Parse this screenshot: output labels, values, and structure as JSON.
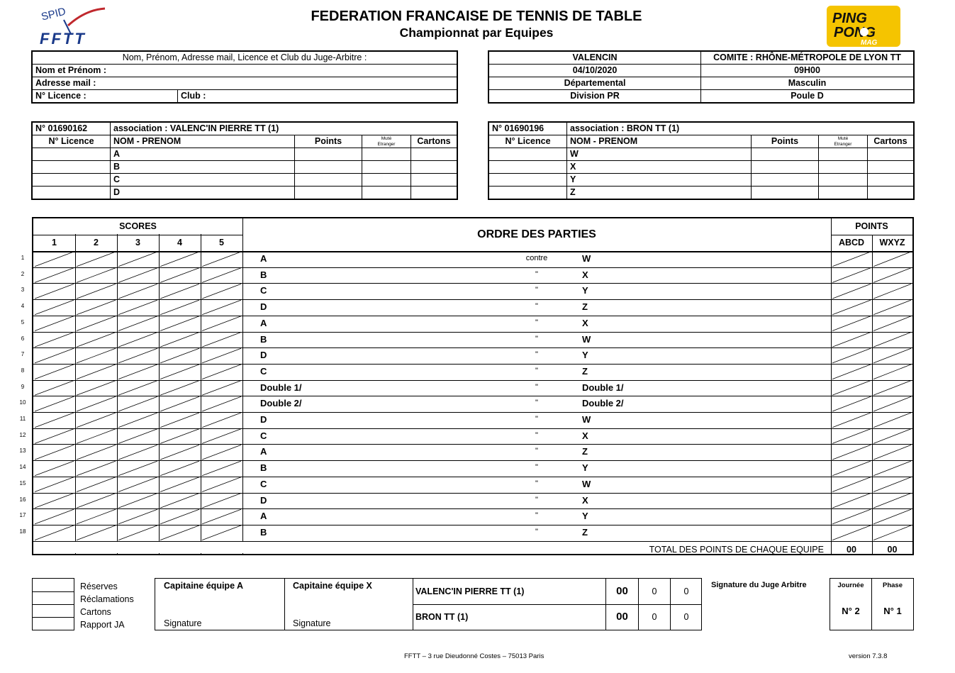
{
  "header": {
    "title": "FEDERATION FRANCAISE DE TENNIS DE TABLE",
    "subtitle": "Championnat par Equipes",
    "logo_left": "SPID FFTT",
    "logo_right": "PING PONG MAG"
  },
  "referee": {
    "heading": "Nom, Prénom, Adresse mail, Licence et Club du Juge-Arbitre :",
    "name_label": "Nom et Prénom :",
    "email_label": "Adresse mail  :",
    "licence_label": "N° Licence     :",
    "club_label": "Club :"
  },
  "match_info": {
    "location": "VALENCIN",
    "committee": "COMITE : RHÔNE-MÉTROPOLE DE LYON TT",
    "date": "04/10/2020",
    "time": "09H00",
    "level": "Départemental",
    "gender": "Masculin",
    "division": "Division  PR",
    "pool": "Poule D"
  },
  "team_a": {
    "number": "N° 01690162",
    "association": "association : VALENC'IN PIERRE TT  (1)",
    "col_licence": "N° Licence",
    "col_name": "NOM - PRENOM",
    "col_points": "Points",
    "col_mute": "Muté",
    "col_etranger": "Etranger",
    "col_cards": "Cartons",
    "players": [
      "A",
      "B",
      "C",
      "D"
    ]
  },
  "team_x": {
    "number": "N° 01690196",
    "association": "association : BRON TT  (1)",
    "col_licence": "N° Licence",
    "col_name": "NOM - PRENOM",
    "col_points": "Points",
    "col_mute": "Muté",
    "col_etranger": "Etranger",
    "col_cards": "Cartons",
    "players": [
      "W",
      "X",
      "Y",
      "Z"
    ]
  },
  "scores": {
    "heading": "SCORES",
    "sets": [
      "1",
      "2",
      "3",
      "4",
      "5"
    ],
    "order_heading": "ORDRE DES PARTIES",
    "points_heading": "POINTS",
    "col_abcd": "ABCD",
    "col_wxyz": "WXYZ",
    "versus_first": "contre",
    "versus_ditto": "\"",
    "matches": [
      {
        "n": "1",
        "home": "A",
        "away": "W"
      },
      {
        "n": "2",
        "home": "B",
        "away": "X"
      },
      {
        "n": "3",
        "home": "C",
        "away": "Y"
      },
      {
        "n": "4",
        "home": "D",
        "away": "Z"
      },
      {
        "n": "5",
        "home": "A",
        "away": "X"
      },
      {
        "n": "6",
        "home": "B",
        "away": "W"
      },
      {
        "n": "7",
        "home": "D",
        "away": "Y"
      },
      {
        "n": "8",
        "home": "C",
        "away": "Z"
      },
      {
        "n": "9",
        "home": "Double 1/",
        "away": "Double 1/"
      },
      {
        "n": "10",
        "home": "Double 2/",
        "away": "Double 2/"
      },
      {
        "n": "11",
        "home": "D",
        "away": "W"
      },
      {
        "n": "12",
        "home": "C",
        "away": "X"
      },
      {
        "n": "13",
        "home": "A",
        "away": "Z"
      },
      {
        "n": "14",
        "home": "B",
        "away": "Y"
      },
      {
        "n": "15",
        "home": "C",
        "away": "W"
      },
      {
        "n": "16",
        "home": "D",
        "away": "X"
      },
      {
        "n": "17",
        "home": "A",
        "away": "Y"
      },
      {
        "n": "18",
        "home": "B",
        "away": "Z"
      }
    ],
    "total_label": "TOTAL DES POINTS DE CHAQUE EQUIPE",
    "total_abcd": "00",
    "total_wxyz": "00"
  },
  "bottom": {
    "reserves": "Réserves",
    "reclamations": "Réclamations",
    "cartons": "Cartons",
    "rapport": "Rapport JA",
    "captain_a": "Capitaine équipe A",
    "captain_x": "Capitaine équipe X",
    "signature_a": "Signature",
    "signature_x": "Signature",
    "result": [
      {
        "team": "VALENC'IN PIERRE TT  (1)",
        "score": "00",
        "v1": "0",
        "v2": "0"
      },
      {
        "team": "BRON TT  (1)",
        "score": "00",
        "v1": "0",
        "v2": "0"
      }
    ],
    "referee_signature": "Signature du Juge Arbitre",
    "journee_label": "Journée",
    "journee_value": "N° 2",
    "phase_label": "Phase",
    "phase_value": "N° 1"
  },
  "footer": {
    "address": "FFTT – 3 rue Dieudonné Costes – 75013 Paris",
    "version": "version 7.3.8"
  }
}
